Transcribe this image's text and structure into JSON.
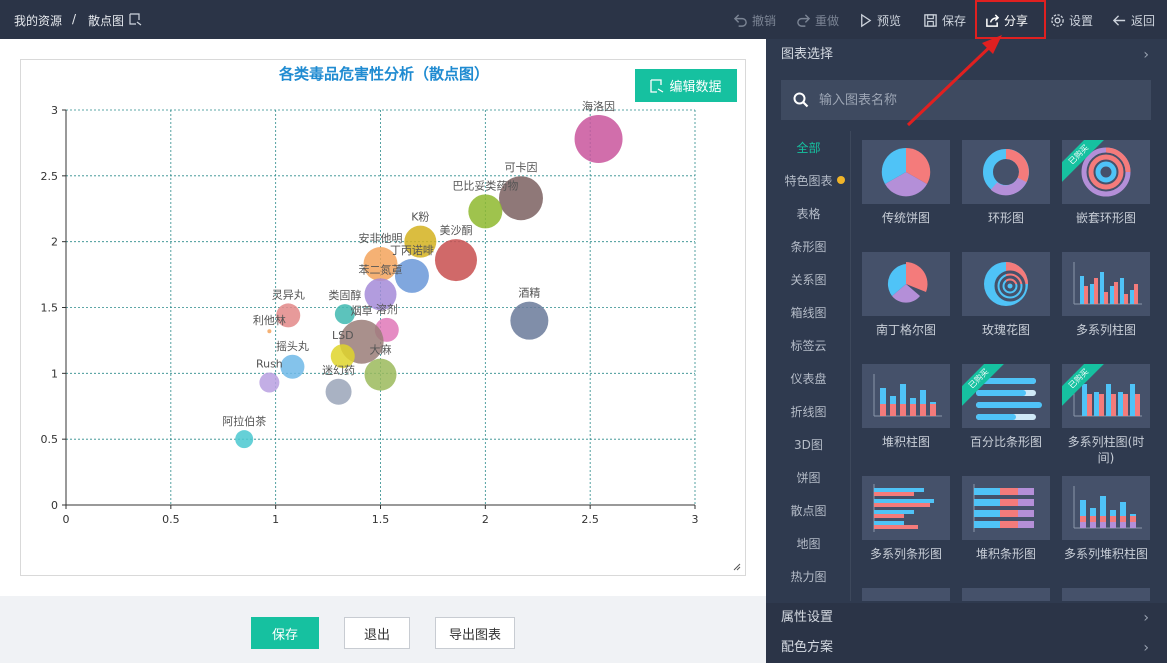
{
  "breadcrumb": {
    "root": "我的资源",
    "sep": "/",
    "current": "散点图"
  },
  "toolbar": {
    "undo": "撤销",
    "redo": "重做",
    "preview": "预览",
    "save": "保存",
    "share": "分享",
    "settings": "设置",
    "back": "返回"
  },
  "editor": {
    "edit_data": "编辑数据"
  },
  "bottom": {
    "save": "保存",
    "exit": "退出",
    "export": "导出图表"
  },
  "panel": {
    "chart_select": "图表选择",
    "search_placeholder": "输入图表名称",
    "categories": [
      "全部",
      "特色图表",
      "表格",
      "条形图",
      "关系图",
      "箱线图",
      "标签云",
      "仪表盘",
      "折线图",
      "3D图",
      "饼图",
      "散点图",
      "地图",
      "热力图"
    ],
    "cards": [
      {
        "label": "传统饼图",
        "badge": ""
      },
      {
        "label": "环形图",
        "badge": ""
      },
      {
        "label": "嵌套环形图",
        "badge": "已购买"
      },
      {
        "label": "南丁格尔图",
        "badge": ""
      },
      {
        "label": "玫瑰花图",
        "badge": ""
      },
      {
        "label": "多系列柱图",
        "badge": ""
      },
      {
        "label": "堆积柱图",
        "badge": ""
      },
      {
        "label": "百分比条形图",
        "badge": "已购买"
      },
      {
        "label": "多系列柱图(时间)",
        "badge": "已购买"
      },
      {
        "label": "多系列条形图",
        "badge": ""
      },
      {
        "label": "堆积条形图",
        "badge": ""
      },
      {
        "label": "多系列堆积柱图",
        "badge": ""
      }
    ],
    "property_settings": "属性设置",
    "color_scheme": "配色方案"
  },
  "colors": {
    "accent": "#16c1a0",
    "topbar": "#2b3447",
    "panel": "#2f3a4f",
    "highlight": "#e02020",
    "title": "#1f8bd1"
  },
  "chart_data": {
    "type": "scatter",
    "title": "各类毒品危害性分析（散点图）",
    "xlim": [
      0,
      3
    ],
    "ylim": [
      0,
      3
    ],
    "xticks": [
      0,
      0.5,
      1,
      1.5,
      2,
      2.5,
      3
    ],
    "yticks": [
      0,
      0.5,
      1,
      1.5,
      2,
      2.5,
      3
    ],
    "grid": true,
    "points": [
      {
        "name": "海洛因",
        "x": 2.54,
        "y": 2.78,
        "size": 24,
        "color": "#c9559c"
      },
      {
        "name": "可卡因",
        "x": 2.17,
        "y": 2.33,
        "size": 22,
        "color": "#7b6060"
      },
      {
        "name": "巴比妥类药物",
        "x": 2.0,
        "y": 2.23,
        "size": 17,
        "color": "#8eb82e"
      },
      {
        "name": "美沙酮",
        "x": 1.86,
        "y": 1.86,
        "size": 21,
        "color": "#c84f4f"
      },
      {
        "name": "K粉",
        "x": 1.69,
        "y": 2.0,
        "size": 16,
        "color": "#d4b21e"
      },
      {
        "name": "丁丙诺啡",
        "x": 1.65,
        "y": 1.74,
        "size": 17,
        "color": "#6a98d8"
      },
      {
        "name": "安非他明",
        "x": 1.5,
        "y": 1.83,
        "size": 17,
        "color": "#f3a35c"
      },
      {
        "name": "苯二氮䓬",
        "x": 1.5,
        "y": 1.6,
        "size": 16,
        "color": "#a48bd8"
      },
      {
        "name": "类固醇",
        "x": 1.33,
        "y": 1.45,
        "size": 10,
        "color": "#3fb8b0"
      },
      {
        "name": "溶剂",
        "x": 1.53,
        "y": 1.33,
        "size": 12,
        "color": "#e078b8"
      },
      {
        "name": "烟草",
        "x": 1.41,
        "y": 1.24,
        "size": 22,
        "color": "#9a7c78"
      },
      {
        "name": "大麻",
        "x": 1.5,
        "y": 0.99,
        "size": 16,
        "color": "#9bba5c"
      },
      {
        "name": "LSD",
        "x": 1.32,
        "y": 1.13,
        "size": 12,
        "color": "#dfd52c"
      },
      {
        "name": "迷幻药",
        "x": 1.3,
        "y": 0.86,
        "size": 13,
        "color": "#9aa4b8"
      },
      {
        "name": "灵异丸",
        "x": 1.06,
        "y": 1.44,
        "size": 12,
        "color": "#e38888"
      },
      {
        "name": "利他林",
        "x": 0.97,
        "y": 1.32,
        "size": 2,
        "color": "#f3a35c"
      },
      {
        "name": "摇头丸",
        "x": 1.08,
        "y": 1.05,
        "size": 12,
        "color": "#6fb8e8"
      },
      {
        "name": "Rush",
        "x": 0.97,
        "y": 0.93,
        "size": 10,
        "color": "#b8a0e0"
      },
      {
        "name": "酒精",
        "x": 2.21,
        "y": 1.4,
        "size": 19,
        "color": "#6a7a9a"
      },
      {
        "name": "阿拉伯茶",
        "x": 0.85,
        "y": 0.5,
        "size": 9,
        "color": "#4ac8d0"
      }
    ]
  }
}
